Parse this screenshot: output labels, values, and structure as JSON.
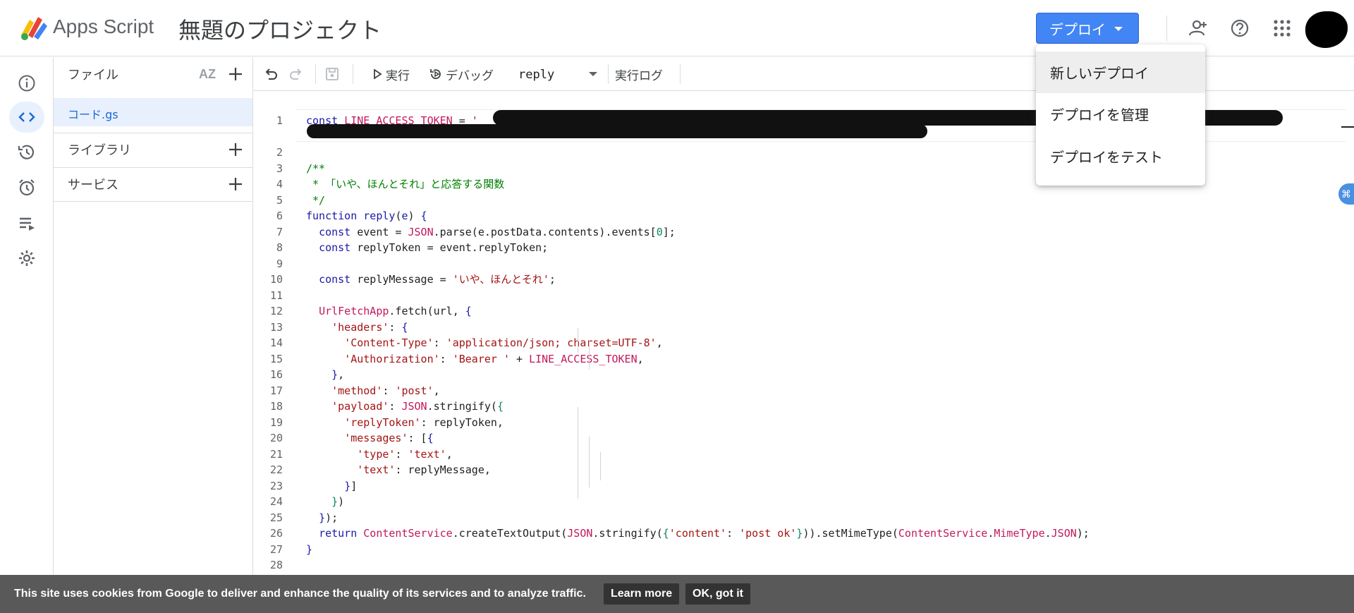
{
  "header": {
    "app_name": "Apps Script",
    "project_title": "無題のプロジェクト",
    "deploy_label": "デプロイ"
  },
  "rail": {
    "items": [
      "info-icon",
      "code-icon",
      "history-icon",
      "alarm-icon",
      "run-list-icon",
      "settings-icon"
    ],
    "active": "code-icon"
  },
  "files": {
    "section_label": "ファイル",
    "sort_label": "AZ",
    "file_name": "コード.gs",
    "library_label": "ライブラリ",
    "services_label": "サービス"
  },
  "toolbar": {
    "run_label": "実行",
    "debug_label": "デバッグ",
    "function_value": "reply",
    "log_label": "実行ログ"
  },
  "deploy_menu": {
    "items": [
      "新しいデプロイ",
      "デプロイを管理",
      "デプロイをテスト"
    ]
  },
  "code_lines": [
    "1",
    "2",
    "3",
    "4",
    "5",
    "6",
    "7",
    "8",
    "9",
    "10",
    "11",
    "12",
    "13",
    "14",
    "15",
    "16",
    "17",
    "18",
    "19",
    "20",
    "21",
    "22",
    "23",
    "24",
    "25",
    "26",
    "27",
    "28"
  ],
  "cookie": {
    "text": "This site uses cookies from Google to deliver and enhance the quality of its services and to analyze traffic.",
    "learn_more": "Learn more",
    "ok": "OK, got it"
  },
  "colors": {
    "accent": "#4285f4",
    "active_bg": "#e8f0fe",
    "cookie_bg": "#595959"
  }
}
